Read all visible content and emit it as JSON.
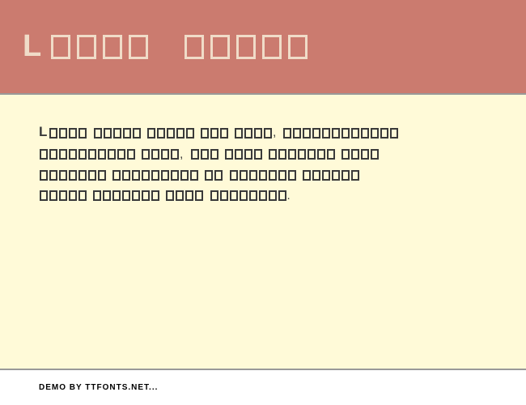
{
  "header": {
    "title_letter": "L",
    "title_boxes_word1": 4,
    "title_boxes_word2": 5
  },
  "content": {
    "first_letter": "L",
    "lines": [
      {
        "boxes": [
          4,
          5,
          5,
          3,
          4
        ],
        "punct": ",",
        "boxes_after": [
          12
        ]
      },
      {
        "boxes": [
          10,
          4
        ],
        "punct": ",",
        "boxes_after": [
          3,
          4,
          7,
          4
        ]
      },
      {
        "boxes": [
          7,
          9,
          2,
          7,
          6
        ]
      },
      {
        "boxes": [
          5,
          7,
          4,
          8
        ],
        "punct_end": "."
      }
    ]
  },
  "footer": {
    "text": "DEMO BY TTFONTS.NET..."
  }
}
